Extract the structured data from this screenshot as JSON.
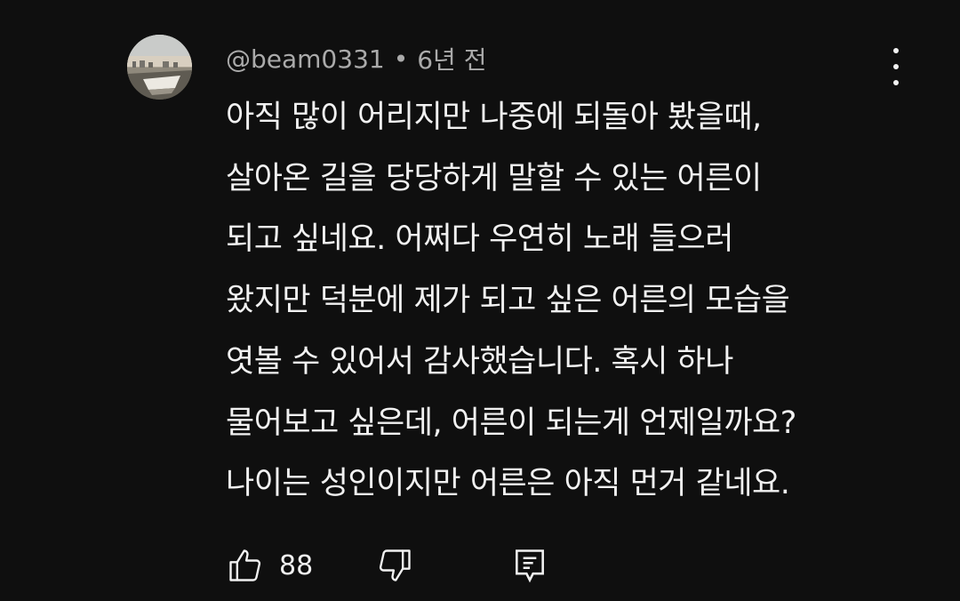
{
  "comment": {
    "author": "@beam0331",
    "separator": "•",
    "time": "6년 전",
    "lines": [
      "아직 많이 어리지만 나중에 되돌아 봤을때,",
      "살아온 길을 당당하게 말할 수 있는 어른이",
      "되고 싶네요. 어쩌다 우연히 노래 들으러",
      "왔지만 덕분에 제가 되고 싶은 어른의 모습을",
      "엿볼 수 있어서 감사했습니다. 혹시 하나",
      "물어보고 싶은데, 어른이 되는게 언제일까요?",
      "나이는 성인이지만 어른은 아직 먼거 같네요."
    ],
    "likes": "88"
  },
  "icons": {
    "like": "thumbs-up-icon",
    "dislike": "thumbs-down-icon",
    "reply": "reply-comment-icon",
    "more": "more-vertical-icon"
  },
  "colors": {
    "background": "#0f0f0f",
    "text": "#f1f1f1",
    "meta": "#aaaaaa"
  }
}
